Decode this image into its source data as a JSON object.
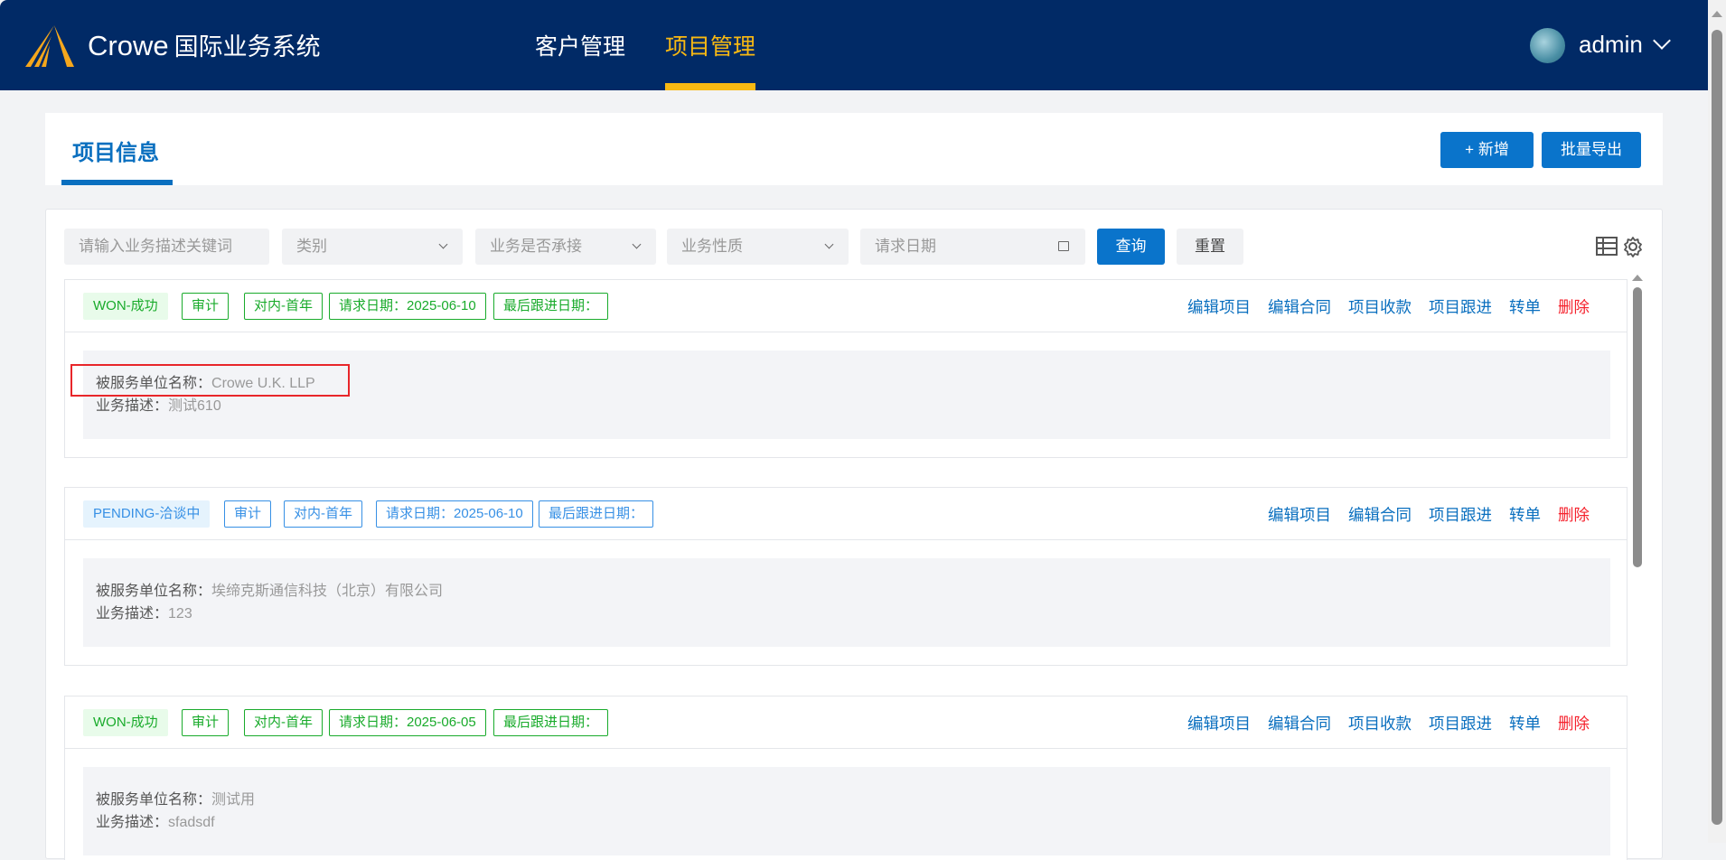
{
  "header": {
    "brand": "Crowe",
    "system": "国际业务系统",
    "nav": [
      {
        "label": "客户管理",
        "active": false
      },
      {
        "label": "项目管理",
        "active": true
      }
    ],
    "user": "admin"
  },
  "page": {
    "title": "项目信息",
    "add_button": "+ 新增",
    "export_button": "批量导出"
  },
  "filters": {
    "keyword_placeholder": "请输入业务描述关键词",
    "category": "类别",
    "accepted": "业务是否承接",
    "nature": "业务性质",
    "date_placeholder": "请求日期",
    "query": "查询",
    "reset": "重置"
  },
  "labels": {
    "client": "被服务单位名称：",
    "desc": "业务描述："
  },
  "projects": [
    {
      "status": "WON-成功",
      "type": "审计",
      "scope": "对内-首年",
      "request_date": "请求日期：2025-06-10",
      "last_follow": "最后跟进日期：",
      "client": "Crowe U.K. LLP",
      "desc": "测试610",
      "actions": [
        "编辑项目",
        "编辑合同",
        "项目收款",
        "项目跟进",
        "转单",
        "删除"
      ]
    },
    {
      "status": "PENDING-洽谈中",
      "type": "审计",
      "scope": "对内-首年",
      "request_date": "请求日期：2025-06-10",
      "last_follow": "最后跟进日期：",
      "client": "埃缔克斯通信科技（北京）有限公司",
      "desc": "123",
      "actions": [
        "编辑项目",
        "编辑合同",
        "项目跟进",
        "转单",
        "删除"
      ]
    },
    {
      "status": "WON-成功",
      "type": "审计",
      "scope": "对内-首年",
      "request_date": "请求日期：2025-06-05",
      "last_follow": "最后跟进日期：",
      "client": "测试用",
      "desc": "sfadsdf",
      "actions": [
        "编辑项目",
        "编辑合同",
        "项目收款",
        "项目跟进",
        "转单",
        "删除"
      ]
    }
  ]
}
